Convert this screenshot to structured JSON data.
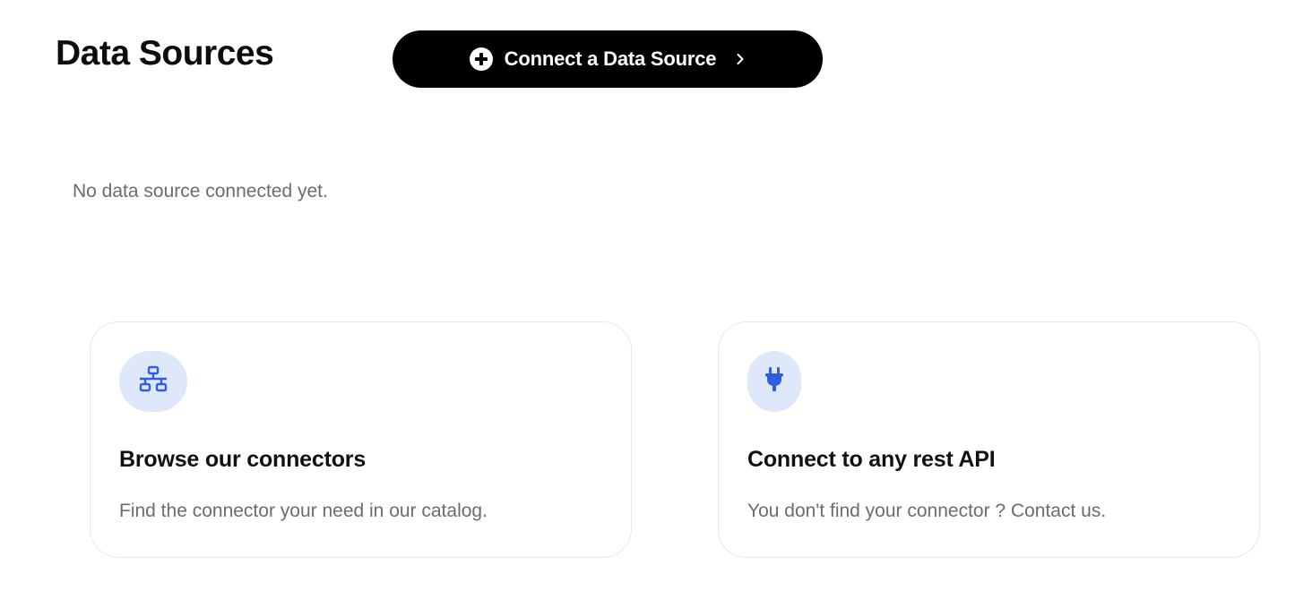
{
  "header": {
    "title": "Data Sources",
    "connect_button_label": "Connect a Data Source",
    "connect_button_icon": "plus-circle-icon",
    "connect_button_chevron": "chevron-right-icon"
  },
  "empty_state": {
    "message": "No data source connected yet."
  },
  "cards": [
    {
      "icon": "network-icon",
      "title": "Browse our connectors",
      "description": "Find the connector your need in our catalog."
    },
    {
      "icon": "plug-icon",
      "title": "Connect to any rest API",
      "description": "You don't find your connector ? Contact us."
    }
  ],
  "colors": {
    "button_bg": "#000000",
    "icon_accent": "#2f5fe0",
    "icon_bg": "#dfe8fb",
    "muted_text": "#6b6b73",
    "card_border": "#e7e7ec"
  }
}
